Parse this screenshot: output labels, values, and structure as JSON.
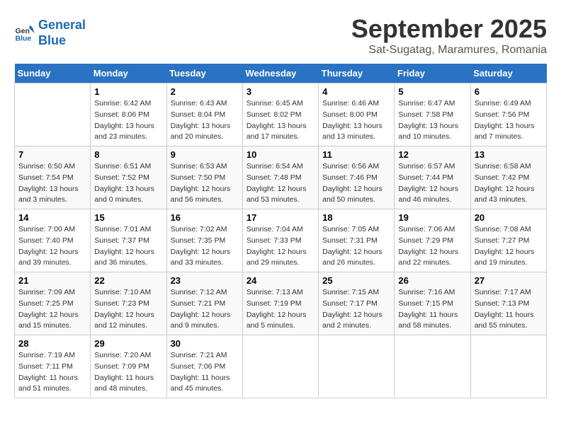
{
  "logo": {
    "line1": "General",
    "line2": "Blue"
  },
  "title": "September 2025",
  "location": "Sat-Sugatag, Maramures, Romania",
  "days_of_week": [
    "Sunday",
    "Monday",
    "Tuesday",
    "Wednesday",
    "Thursday",
    "Friday",
    "Saturday"
  ],
  "weeks": [
    [
      {
        "day": "",
        "info": ""
      },
      {
        "day": "1",
        "info": "Sunrise: 6:42 AM\nSunset: 8:06 PM\nDaylight: 13 hours\nand 23 minutes."
      },
      {
        "day": "2",
        "info": "Sunrise: 6:43 AM\nSunset: 8:04 PM\nDaylight: 13 hours\nand 20 minutes."
      },
      {
        "day": "3",
        "info": "Sunrise: 6:45 AM\nSunset: 8:02 PM\nDaylight: 13 hours\nand 17 minutes."
      },
      {
        "day": "4",
        "info": "Sunrise: 6:46 AM\nSunset: 8:00 PM\nDaylight: 13 hours\nand 13 minutes."
      },
      {
        "day": "5",
        "info": "Sunrise: 6:47 AM\nSunset: 7:58 PM\nDaylight: 13 hours\nand 10 minutes."
      },
      {
        "day": "6",
        "info": "Sunrise: 6:49 AM\nSunset: 7:56 PM\nDaylight: 13 hours\nand 7 minutes."
      }
    ],
    [
      {
        "day": "7",
        "info": "Sunrise: 6:50 AM\nSunset: 7:54 PM\nDaylight: 13 hours\nand 3 minutes."
      },
      {
        "day": "8",
        "info": "Sunrise: 6:51 AM\nSunset: 7:52 PM\nDaylight: 13 hours\nand 0 minutes."
      },
      {
        "day": "9",
        "info": "Sunrise: 6:53 AM\nSunset: 7:50 PM\nDaylight: 12 hours\nand 56 minutes."
      },
      {
        "day": "10",
        "info": "Sunrise: 6:54 AM\nSunset: 7:48 PM\nDaylight: 12 hours\nand 53 minutes."
      },
      {
        "day": "11",
        "info": "Sunrise: 6:56 AM\nSunset: 7:46 PM\nDaylight: 12 hours\nand 50 minutes."
      },
      {
        "day": "12",
        "info": "Sunrise: 6:57 AM\nSunset: 7:44 PM\nDaylight: 12 hours\nand 46 minutes."
      },
      {
        "day": "13",
        "info": "Sunrise: 6:58 AM\nSunset: 7:42 PM\nDaylight: 12 hours\nand 43 minutes."
      }
    ],
    [
      {
        "day": "14",
        "info": "Sunrise: 7:00 AM\nSunset: 7:40 PM\nDaylight: 12 hours\nand 39 minutes."
      },
      {
        "day": "15",
        "info": "Sunrise: 7:01 AM\nSunset: 7:37 PM\nDaylight: 12 hours\nand 36 minutes."
      },
      {
        "day": "16",
        "info": "Sunrise: 7:02 AM\nSunset: 7:35 PM\nDaylight: 12 hours\nand 33 minutes."
      },
      {
        "day": "17",
        "info": "Sunrise: 7:04 AM\nSunset: 7:33 PM\nDaylight: 12 hours\nand 29 minutes."
      },
      {
        "day": "18",
        "info": "Sunrise: 7:05 AM\nSunset: 7:31 PM\nDaylight: 12 hours\nand 26 minutes."
      },
      {
        "day": "19",
        "info": "Sunrise: 7:06 AM\nSunset: 7:29 PM\nDaylight: 12 hours\nand 22 minutes."
      },
      {
        "day": "20",
        "info": "Sunrise: 7:08 AM\nSunset: 7:27 PM\nDaylight: 12 hours\nand 19 minutes."
      }
    ],
    [
      {
        "day": "21",
        "info": "Sunrise: 7:09 AM\nSunset: 7:25 PM\nDaylight: 12 hours\nand 15 minutes."
      },
      {
        "day": "22",
        "info": "Sunrise: 7:10 AM\nSunset: 7:23 PM\nDaylight: 12 hours\nand 12 minutes."
      },
      {
        "day": "23",
        "info": "Sunrise: 7:12 AM\nSunset: 7:21 PM\nDaylight: 12 hours\nand 9 minutes."
      },
      {
        "day": "24",
        "info": "Sunrise: 7:13 AM\nSunset: 7:19 PM\nDaylight: 12 hours\nand 5 minutes."
      },
      {
        "day": "25",
        "info": "Sunrise: 7:15 AM\nSunset: 7:17 PM\nDaylight: 12 hours\nand 2 minutes."
      },
      {
        "day": "26",
        "info": "Sunrise: 7:16 AM\nSunset: 7:15 PM\nDaylight: 11 hours\nand 58 minutes."
      },
      {
        "day": "27",
        "info": "Sunrise: 7:17 AM\nSunset: 7:13 PM\nDaylight: 11 hours\nand 55 minutes."
      }
    ],
    [
      {
        "day": "28",
        "info": "Sunrise: 7:19 AM\nSunset: 7:11 PM\nDaylight: 11 hours\nand 51 minutes."
      },
      {
        "day": "29",
        "info": "Sunrise: 7:20 AM\nSunset: 7:09 PM\nDaylight: 11 hours\nand 48 minutes."
      },
      {
        "day": "30",
        "info": "Sunrise: 7:21 AM\nSunset: 7:06 PM\nDaylight: 11 hours\nand 45 minutes."
      },
      {
        "day": "",
        "info": ""
      },
      {
        "day": "",
        "info": ""
      },
      {
        "day": "",
        "info": ""
      },
      {
        "day": "",
        "info": ""
      }
    ]
  ]
}
